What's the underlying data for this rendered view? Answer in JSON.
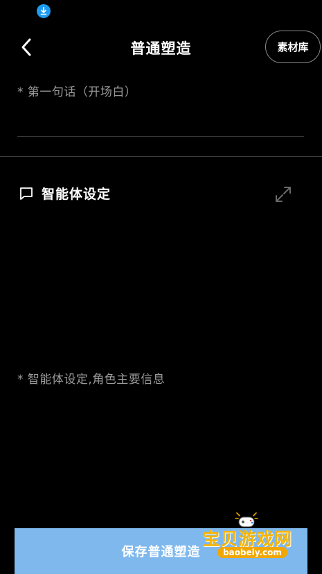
{
  "header": {
    "title": "普通塑造",
    "back_icon": "chevron-left-icon",
    "library_label": "素材库"
  },
  "status_bar": {
    "download_icon": "download-icon",
    "accent_color": "#1e9bf0"
  },
  "first_sentence": {
    "placeholder": "* 第一句话（开场白）",
    "value": ""
  },
  "agent_settings": {
    "title": "智能体设定",
    "icon": "chat-bubble-icon",
    "expand_icon": "expand-icon",
    "placeholder": "* 智能体设定,角色主要信息",
    "value": ""
  },
  "footer": {
    "save_label": "保存普通塑造",
    "button_color": "#7fb8ec"
  },
  "watermark": {
    "text": "宝贝游戏网",
    "url": "baobeiy.com"
  }
}
